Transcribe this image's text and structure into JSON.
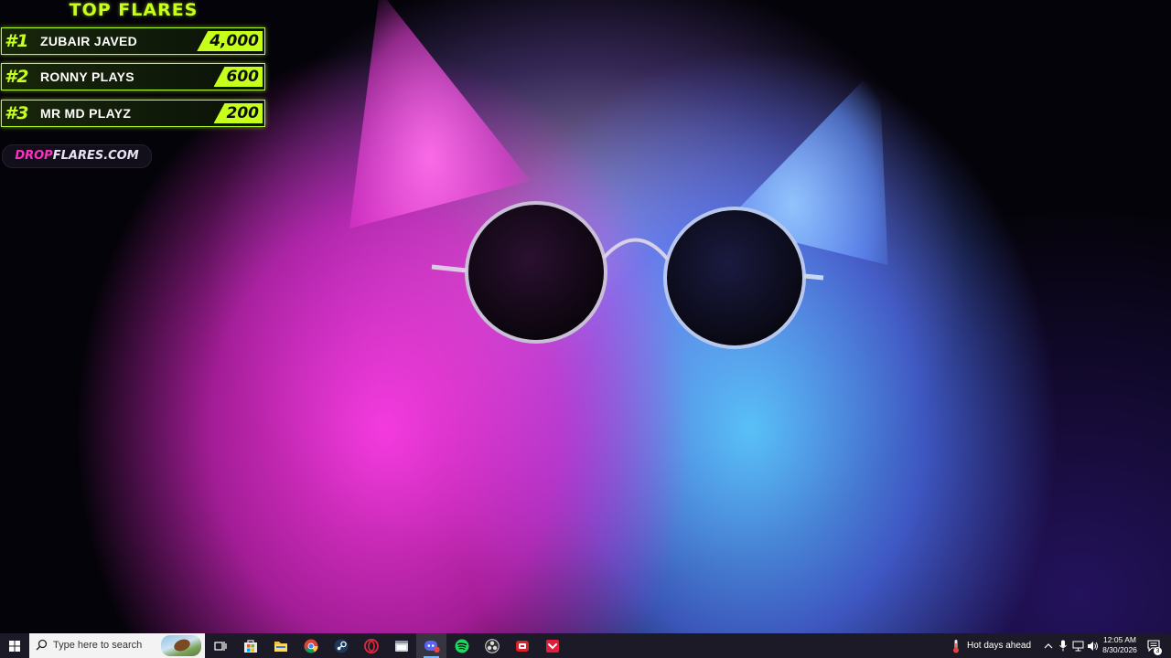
{
  "leaderboard": {
    "title": "TOP FLARES",
    "entries": [
      {
        "rank": "#1",
        "name": "ZUBAIR JAVED",
        "amount": "4,000"
      },
      {
        "rank": "#2",
        "name": "RONNY PLAYS",
        "amount": "600"
      },
      {
        "rank": "#3",
        "name": "MR MD PLAYZ",
        "amount": "200"
      }
    ],
    "site_prefix": "DROP",
    "site_suffix": "FLARES.COM",
    "accent_color": "#c6ff1a",
    "site_accent_color": "#ff2fc2"
  },
  "wallpaper": {
    "subject_icon": "cat-with-sunglasses",
    "colors": [
      "#ff3ce6",
      "#5ac8ff",
      "#05030a"
    ]
  },
  "taskbar": {
    "start_icon": "windows-logo-icon",
    "search_placeholder": "Type here to search",
    "apps": [
      {
        "name": "task-view",
        "icon": "task-view-icon"
      },
      {
        "name": "microsoft-store",
        "icon": "store-icon"
      },
      {
        "name": "file-explorer",
        "icon": "folder-icon"
      },
      {
        "name": "google-chrome",
        "icon": "chrome-icon"
      },
      {
        "name": "steam",
        "icon": "steam-icon"
      },
      {
        "name": "opera-gx",
        "icon": "opera-icon"
      },
      {
        "name": "app-window",
        "icon": "window-icon"
      },
      {
        "name": "discord",
        "icon": "discord-icon",
        "active": true
      },
      {
        "name": "spotify",
        "icon": "spotify-icon"
      },
      {
        "name": "obs-studio",
        "icon": "obs-icon"
      },
      {
        "name": "red-app",
        "icon": "red-app-icon"
      },
      {
        "name": "red-arrow-app",
        "icon": "red-arrow-icon"
      }
    ],
    "weather_text": "Hot days ahead",
    "time": "12:05 AM",
    "date": "8/30/2026",
    "notification_count": "3"
  }
}
